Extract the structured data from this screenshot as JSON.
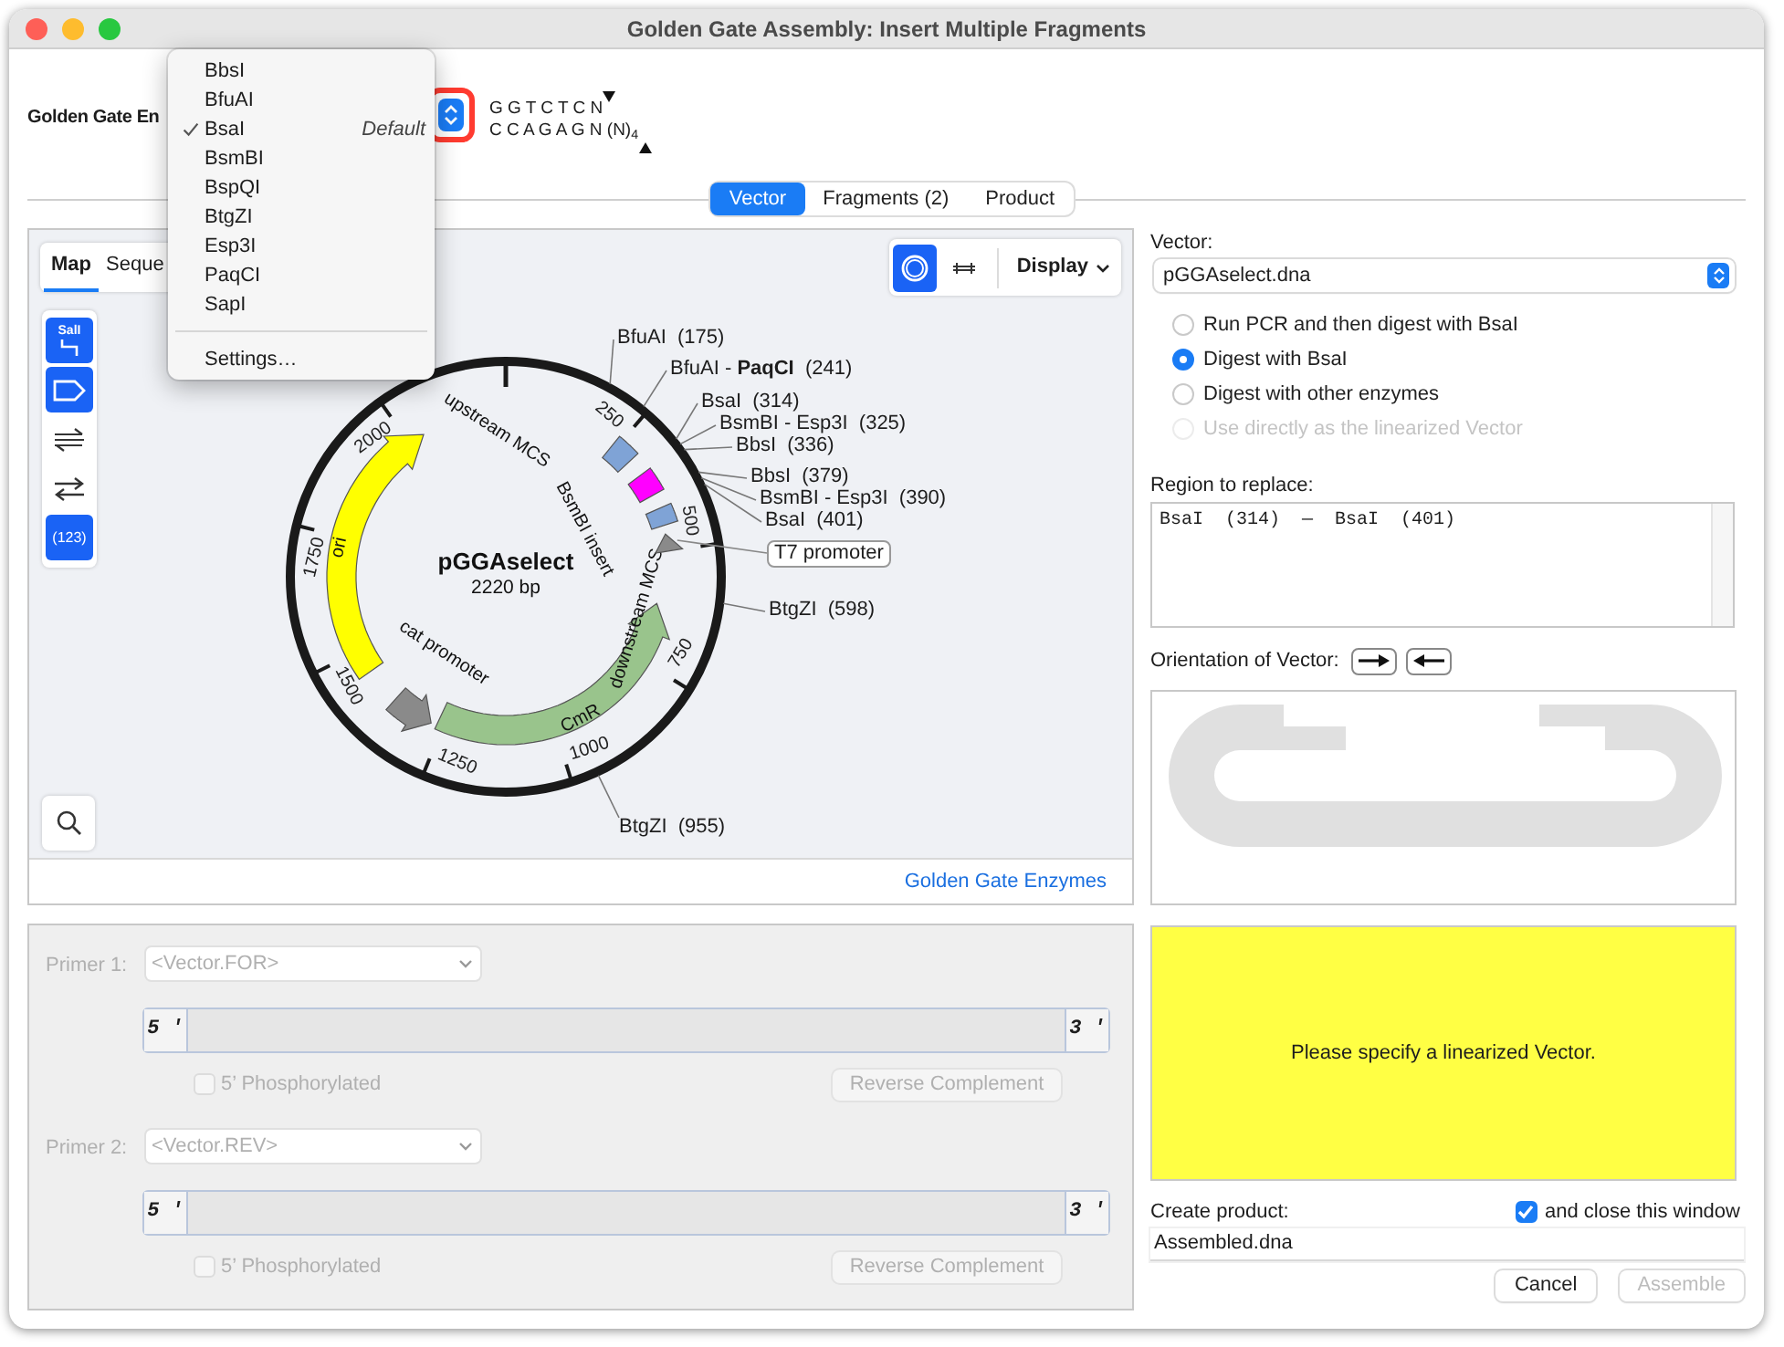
{
  "window": {
    "title": "Golden Gate Assembly: Insert Multiple Fragments"
  },
  "header": {
    "label": "Golden Gate En",
    "site_top": "G G T C T C N",
    "site_bottom": "C C A G A G N (N)$_{4}$"
  },
  "enzyme_menu": {
    "items": [
      {
        "label": "BbsI",
        "selected": false
      },
      {
        "label": "BfuAI",
        "selected": false
      },
      {
        "label": "BsaI",
        "selected": true,
        "note": "Default"
      },
      {
        "label": "BsmBI",
        "selected": false
      },
      {
        "label": "BspQI",
        "selected": false
      },
      {
        "label": "BtgZI",
        "selected": false
      },
      {
        "label": "Esp3I",
        "selected": false
      },
      {
        "label": "PaqCI",
        "selected": false
      },
      {
        "label": "SapI",
        "selected": false
      }
    ],
    "settings": "Settings…"
  },
  "tabs": [
    {
      "label": "Vector",
      "selected": true
    },
    {
      "label": "Fragments (2)",
      "selected": false
    },
    {
      "label": "Product",
      "selected": false
    }
  ],
  "map": {
    "view_tabs": [
      {
        "label": "Map",
        "selected": true
      },
      {
        "label": "Seque",
        "selected": false
      }
    ],
    "tools": [
      {
        "kind": "enzymes",
        "text": "SalI",
        "on": true
      },
      {
        "kind": "features",
        "on": true
      },
      {
        "kind": "translations",
        "on": false
      },
      {
        "kind": "primers",
        "on": false
      },
      {
        "kind": "numbers",
        "text": "(123)",
        "on": true
      }
    ],
    "views": [
      {
        "kind": "circular",
        "selected": true
      },
      {
        "kind": "linear",
        "selected": false
      }
    ],
    "display": "Display",
    "name": "pGGAselect",
    "length": "2220 bp",
    "ticks": [
      "250",
      "500",
      "750",
      "1000",
      "1250",
      "1500",
      "1750",
      "2000"
    ],
    "features": [
      {
        "label": "ori",
        "kind": "arrow",
        "color": "#ffff00"
      },
      {
        "label": "CmR",
        "kind": "arrow",
        "color": "#99c48c"
      },
      {
        "label": "cat promoter",
        "kind": "arrow",
        "color": "#8a8a8a"
      },
      {
        "label": "upstream MCS",
        "kind": "block",
        "color": "#7fa3d6"
      },
      {
        "label": "BsmBI insert",
        "kind": "block",
        "color": "#ff00ff"
      },
      {
        "label": "downstream MCS",
        "kind": "block",
        "color": "#7fa3d6"
      },
      {
        "label": "T7 promoter",
        "kind": "arrow",
        "color": "#8a8a8a"
      }
    ],
    "sites": [
      "BfuAI  (175)",
      "BfuAI - **PaqCI**  (241)",
      "BsaI  (314)",
      "BsmBI - Esp3I  (325)",
      "BbsI  (336)",
      "BbsI  (379)",
      "BsmBI - Esp3I  (390)",
      "BsaI  (401)",
      "BtgZI  (598)",
      "BtgZI  (955)"
    ],
    "footer_link": "Golden Gate Enzymes"
  },
  "primer_panel": {
    "disabled": true,
    "primers": [
      {
        "label": "Primer 1:",
        "value": "<Vector.FOR>",
        "five": "5 '",
        "three": "3 '",
        "phosphorylated": false,
        "phos_label": "5’ Phosphorylated",
        "action": "Reverse Complement"
      },
      {
        "label": "Primer 2:",
        "value": "<Vector.REV>",
        "five": "5 '",
        "three": "3 '",
        "phosphorylated": false,
        "phos_label": "5’ Phosphorylated",
        "action": "Reverse Complement"
      }
    ]
  },
  "vector": {
    "label": "Vector:",
    "file": "pGGAselect.dna",
    "options": [
      {
        "label": "Run PCR and then digest with BsaI",
        "selected": false,
        "disabled": false
      },
      {
        "label": "Digest with BsaI",
        "selected": true,
        "disabled": false
      },
      {
        "label": "Digest with other enzymes",
        "selected": false,
        "disabled": false
      },
      {
        "label": "Use directly as the linearized Vector",
        "selected": false,
        "disabled": true
      }
    ]
  },
  "region": {
    "label": "Region to replace:",
    "value": "BsaI  (314)  —  BsaI  (401)"
  },
  "orientation": {
    "label": "Orientation of Vector:"
  },
  "message": "Please specify a linearized Vector.",
  "product": {
    "label": "Create product:",
    "close_checked": true,
    "close_label": "and close this window",
    "filename": "Assembled.dna"
  },
  "buttons": [
    {
      "label": "Cancel",
      "disabled": false
    },
    {
      "label": "Assemble",
      "disabled": true
    }
  ]
}
